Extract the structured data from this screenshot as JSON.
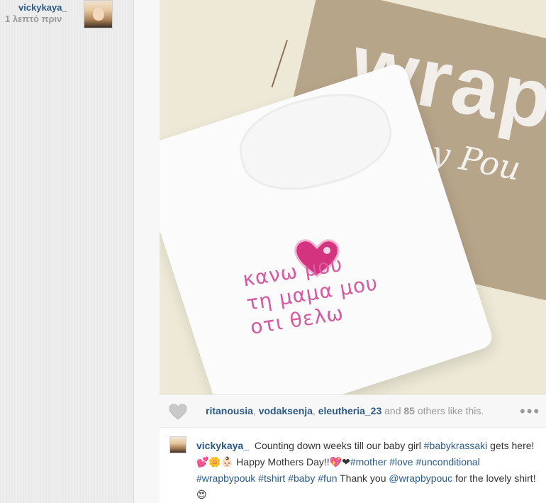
{
  "header": {
    "username": "vickykaya_",
    "timestamp": "1 λεπτό πριν"
  },
  "photo": {
    "embroidery_lines": [
      "κανω μου",
      "τη μαμα μου",
      "οτι θελω"
    ],
    "watermark": "wrap",
    "watermark_script": "by Pou"
  },
  "likes": {
    "users": [
      "ritanousia",
      "vodaksenja",
      "eleutheria_23"
    ],
    "and_word": "and",
    "count": "85",
    "suffix": "others like this."
  },
  "caption": {
    "author": "vickykaya_",
    "text_a": "Counting down weeks till our baby girl",
    "tag_1": "#babykrassaki",
    "text_b": "gets here!💕🌼👶🏻 Happy Mothers Day!!💖❤",
    "tag_2": "#mother",
    "tag_3": "#love",
    "tag_4": "#unconditional",
    "tag_5": "#wrapbypouk",
    "tag_6": "#tshirt",
    "tag_7": "#baby",
    "tag_8": "#fun",
    "text_c": "Thank you",
    "mention": "@wrapbypouc",
    "text_d": "for the lovely shirt!😍"
  },
  "colors": {
    "link": "#2b5a87",
    "muted": "#999999",
    "embroidery": "#d65a9f"
  },
  "icons": {
    "like": "heart-icon",
    "more": "more-dots-icon"
  }
}
